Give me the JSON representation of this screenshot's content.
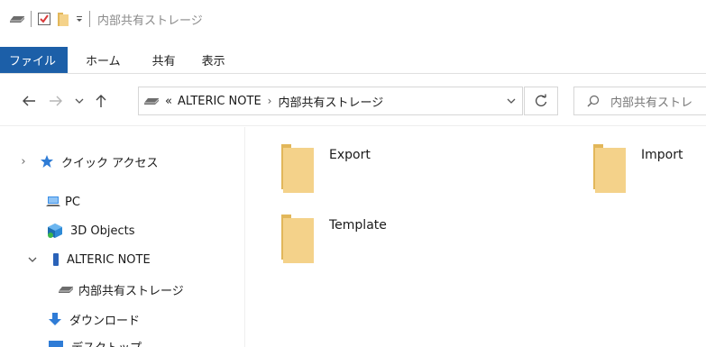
{
  "window": {
    "title": "内部共有ストレージ"
  },
  "quick_access_toolbar": {
    "icons": [
      "drive-icon",
      "checkbox-properties-icon",
      "folder-icon",
      "dropdown-icon"
    ]
  },
  "ribbon": {
    "tabs": [
      {
        "label": "ファイル",
        "active": true
      },
      {
        "label": "ホーム"
      },
      {
        "label": "共有"
      },
      {
        "label": "表示"
      }
    ]
  },
  "address": {
    "overflow": "«",
    "crumbs": [
      "ALTERIC NOTE",
      "内部共有ストレージ"
    ]
  },
  "search": {
    "placeholder": "内部共有ストレ"
  },
  "navigation": {
    "items": [
      {
        "label": "クイック アクセス",
        "icon": "star-icon"
      },
      {
        "label": "PC",
        "icon": "pc-icon"
      },
      {
        "label": "3D Objects",
        "icon": "3d-objects-icon"
      },
      {
        "label": "ALTERIC NOTE",
        "icon": "device-icon"
      },
      {
        "label": "内部共有ストレージ",
        "icon": "drive-icon"
      },
      {
        "label": "ダウンロード",
        "icon": "download-icon"
      },
      {
        "label": "デスクトップ",
        "icon": "desktop-icon"
      }
    ]
  },
  "files": [
    {
      "name": "Export"
    },
    {
      "name": "Import"
    },
    {
      "name": "Template"
    }
  ],
  "colors": {
    "file_tab": "#1c5fa8",
    "folder": "#f4d28a",
    "folder_dark": "#e2b75a"
  }
}
